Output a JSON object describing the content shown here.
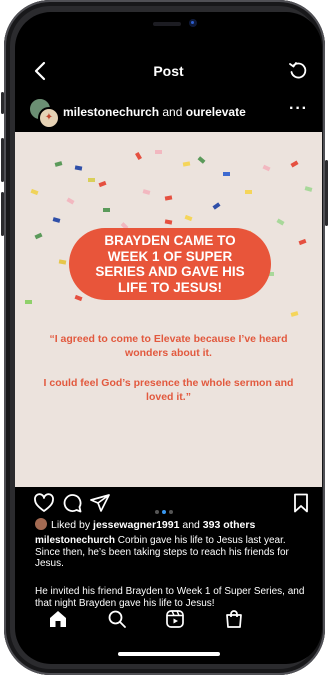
{
  "topbar": {
    "title": "Post"
  },
  "post_header": {
    "account_primary": "milestonechurch",
    "conjunction": " and ",
    "account_secondary": "ourelevate",
    "more": "···"
  },
  "post_image": {
    "headline": "BRAYDEN CAME TO WEEK 1 OF SUPER SERIES AND GAVE HIS LIFE TO JESUS!",
    "quote_line_1": "“I agreed to come to Elevate because I’ve heard wonders about it.",
    "quote_line_2": "I could feel God’s presence the whole sermon and loved it.”"
  },
  "carousel": {
    "count": 3,
    "active_index": 1
  },
  "likes": {
    "prefix": "Liked by ",
    "user": "jessewagner1991",
    "middle": " and ",
    "others": "393 others"
  },
  "caption": {
    "author": "milestonechurch",
    "text_1": " Corbin gave his life to Jesus last year. Since then, he’s been taking steps to reach his friends for Jesus.",
    "text_2": "He invited his friend Brayden to Week 1 of Super Series, and that night Brayden gave his life to Jesus!"
  },
  "icons": {
    "back": "back-arrow-icon",
    "refresh": "refresh-icon",
    "like": "heart-icon",
    "comment": "comment-icon",
    "share": "share-icon",
    "save": "bookmark-icon",
    "home": "home-icon",
    "search": "search-icon",
    "reels": "reels-icon",
    "shop": "shop-icon"
  },
  "colors": {
    "post_background": "#ece3dd",
    "pill": "#e8553a",
    "quote_text": "#e2593e",
    "active_dot": "#3897f0"
  }
}
